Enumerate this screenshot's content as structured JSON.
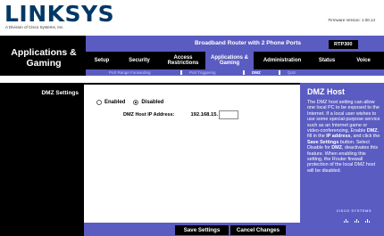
{
  "header": {
    "logo": "LINKSYS",
    "logo_sub": "A Division of Cisco Systems, Inc.",
    "firmware": "Firmware Version: 1.00.14"
  },
  "brandbar": {
    "product": "Broadband Router with 2 Phone Ports",
    "model": "RTP300"
  },
  "section_title": "Applications & Gaming",
  "tabs": [
    {
      "label": "Setup"
    },
    {
      "label": "Security"
    },
    {
      "label": "Access Restrictions"
    },
    {
      "label": "Applications & Gaming"
    },
    {
      "label": "Administration"
    },
    {
      "label": "Status"
    },
    {
      "label": "Voice"
    }
  ],
  "subtabs": [
    {
      "label": "Port Range Forwarding"
    },
    {
      "label": "Port Triggering"
    },
    {
      "label": "DMZ"
    },
    {
      "label": "QoS"
    }
  ],
  "sidebar": {
    "label": "DMZ Settings"
  },
  "content": {
    "enabled_label": "Enabled",
    "disabled_label": "Disabled",
    "selected": "Disabled",
    "ip_label": "DMZ Host IP Address:",
    "ip_prefix": "192.168.15.",
    "ip_last_octet": ""
  },
  "help": {
    "title": "DMZ Host",
    "p1": "The DMZ host setting can allow one local PC to be exposed to the Internet. If a local user wishes to use some special-purpose service such as an Internet game or video-conferencing, Enable ",
    "b1": "DMZ",
    "p2": ", fill in the ",
    "b2": "IP address",
    "p3": ", and click the ",
    "b3": "Save Settings",
    "p4": " button. Select Disable for ",
    "b4": "DMZ",
    "p5": ", deactivates this feature. When enabling this setting, the Router firewall protection of the local DMZ host will be disabled.",
    "cisco": "CISCO SYSTEMS"
  },
  "footer": {
    "save_label": "Save Settings",
    "cancel_label": "Cancel Changes"
  },
  "colors": {
    "accent": "#5b5cc2",
    "dark": "#000000",
    "logo": "#003865"
  }
}
